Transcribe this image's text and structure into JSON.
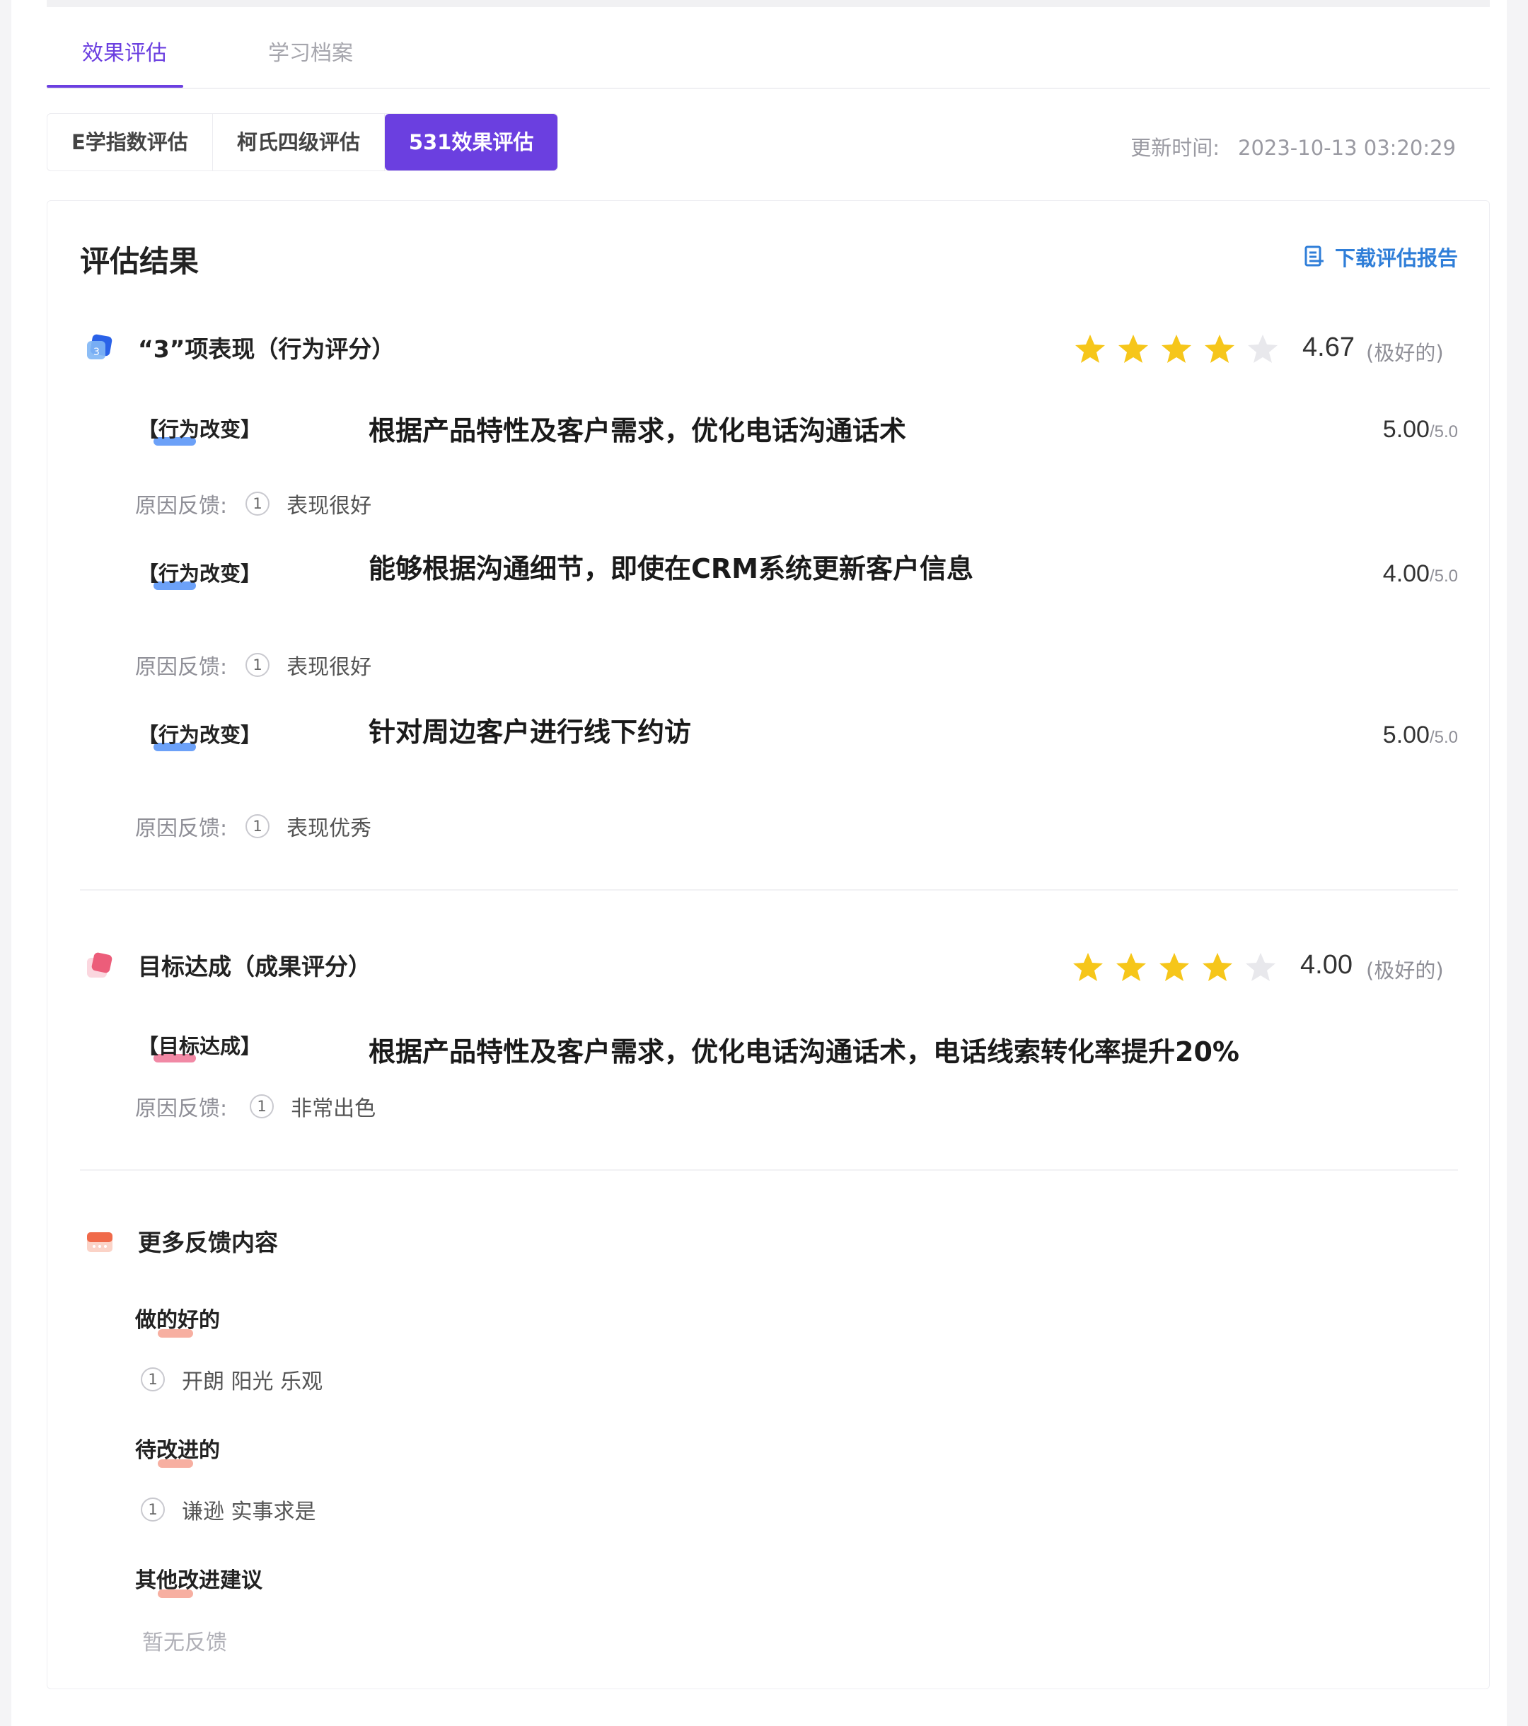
{
  "tabs": [
    {
      "label": "效果评估",
      "active": true
    },
    {
      "label": "学习档案",
      "active": false
    }
  ],
  "segments": [
    {
      "label": "E学指数评估",
      "active": false
    },
    {
      "label": "柯氏四级评估",
      "active": false
    },
    {
      "label": "531效果评估",
      "active": true
    }
  ],
  "update": {
    "label": "更新时间:",
    "value": "2023-10-13 03:20:29"
  },
  "card": {
    "title": "评估结果",
    "download_label": "下载评估报告"
  },
  "behavior": {
    "title": "“3”项表现（行为评分）",
    "score": "4.67",
    "rating_stars": 4.67,
    "desc": "(极好的)",
    "items": [
      {
        "tag": "【行为改变】",
        "text": "根据产品特性及客户需求，优化电话沟通话术",
        "score": "5.00",
        "max": "/5.0",
        "reason_label": "原因反馈:",
        "reason_num": "1",
        "reason": "表现很好"
      },
      {
        "tag": "【行为改变】",
        "text": "能够根据沟通细节，即使在CRM系统更新客户信息",
        "score": "4.00",
        "max": "/5.0",
        "reason_label": "原因反馈:",
        "reason_num": "1",
        "reason": "表现很好"
      },
      {
        "tag": "【行为改变】",
        "text": "针对周边客户进行线下约访",
        "score": "5.00",
        "max": "/5.0",
        "reason_label": "原因反馈:",
        "reason_num": "1",
        "reason": "表现优秀"
      }
    ]
  },
  "goal": {
    "title": "目标达成（成果评分）",
    "score": "4.00",
    "rating_stars": 4,
    "desc": "(极好的)",
    "item": {
      "tag": "【目标达成】",
      "text": "根据产品特性及客户需求，优化电话沟通话术，电话线索转化率提升20%",
      "reason_label": "原因反馈:",
      "reason_num": "1",
      "reason": "非常出色"
    }
  },
  "more": {
    "title": "更多反馈内容",
    "good_title": "做的好的",
    "good_num": "1",
    "good_text": "开朗 阳光 乐观",
    "improve_title": "待改进的",
    "improve_num": "1",
    "improve_text": "谦逊 实事求是",
    "other_title": "其他改进建议",
    "other_text": "暂无反馈"
  },
  "colors": {
    "accent": "#6b3fe0",
    "link": "#2f7ed8",
    "star": "#f6c61a",
    "star_empty": "#e8e8ec"
  },
  "icons": [
    "document-icon",
    "blue-cube-icon",
    "pink-cube-icon",
    "red-card-icon",
    "star-icon"
  ]
}
